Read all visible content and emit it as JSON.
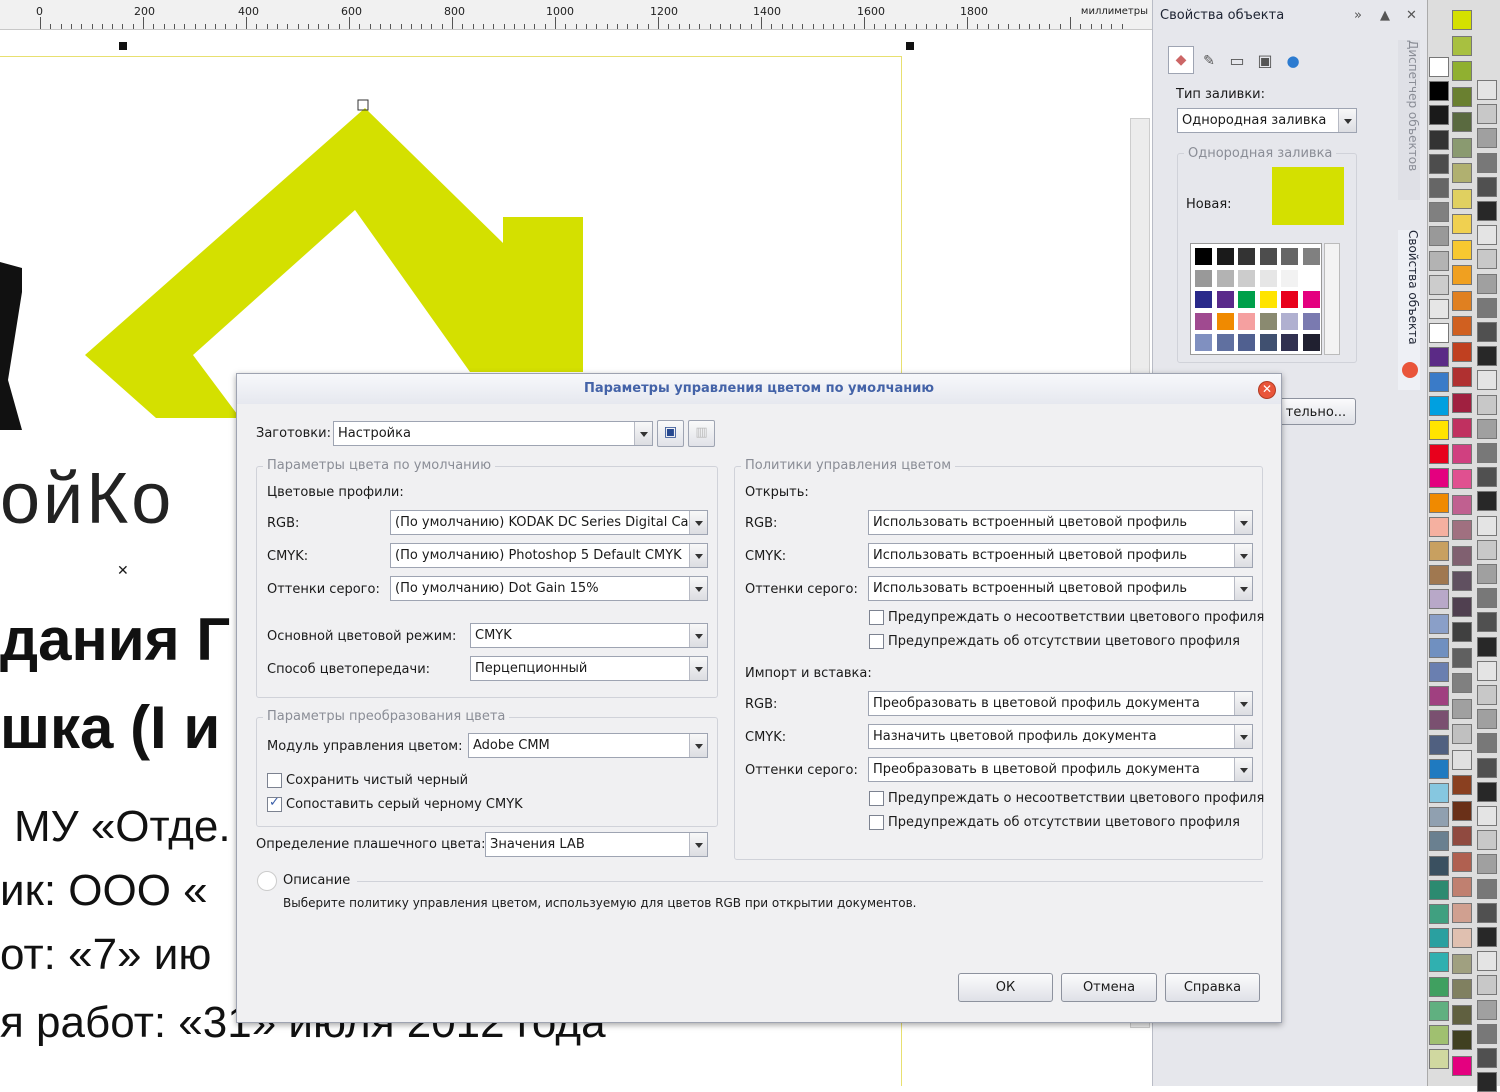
{
  "ruler": {
    "labels": [
      "0",
      "200",
      "400",
      "600",
      "800",
      "1000",
      "1200",
      "1400",
      "1600",
      "1800"
    ],
    "unit": "миллиметры"
  },
  "document": {
    "lines": [
      "ойКо",
      "дания Г",
      "шка (I и",
      "МУ «Отде.",
      "ик: ООО «",
      "от: «7» ию",
      "я работ: «31» июля 2012 года"
    ]
  },
  "panel": {
    "title": "Свойства объекта",
    "fill_type_label": "Тип заливки:",
    "fill_type_value": "Однородная заливка",
    "uniform_group": "Однородная заливка",
    "new_label": "Новая:",
    "fill_color": "#d4e000",
    "more_button": "тельно...",
    "side_tab_manager": "Диспетчер объектов",
    "side_tab_props": "Свойства объекта"
  },
  "dialog": {
    "title": "Параметры управления цветом по умолчанию",
    "presets_label": "Заготовки:",
    "presets_value": "Настройка",
    "default_color_group": "Параметры цвета по умолчанию",
    "profiles_label": "Цветовые профили:",
    "rgb_label": "RGB:",
    "rgb_value": "(По умолчанию) KODAK DC Series Digital Ca...",
    "cmyk_label": "CMYK:",
    "cmyk_value": "(По умолчанию) Photoshop 5 Default CMYK",
    "gray_label": "Оттенки серого:",
    "gray_value": "(По умолчанию) Dot Gain 15%",
    "primary_mode_label": "Основной цветовой режим:",
    "primary_mode_value": "CMYK",
    "rendering_label": "Способ цветопередачи:",
    "rendering_value": "Перцепционный",
    "conversion_group": "Параметры преобразования цвета",
    "cmm_label": "Модуль управления цветом:",
    "cmm_value": "Adobe CMM",
    "preserve_black": "Сохранить чистый черный",
    "preserve_black_checked": false,
    "map_gray": "Сопоставить серый черному CMYK",
    "map_gray_checked": true,
    "spot_label": "Определение плашечного цвета:",
    "spot_value": "Значения LAB",
    "policy_group": "Политики управления цветом",
    "open_label": "Открыть:",
    "open_rgb": "Использовать встроенный цветовой профиль",
    "open_cmyk": "Использовать встроенный цветовой профиль",
    "open_gray": "Использовать встроенный цветовой профиль",
    "warn_mismatch": "Предупреждать о несоответствии цветового профиля",
    "warn_missing": "Предупреждать об отсутствии цветового профиля",
    "import_label": "Импорт и вставка:",
    "import_rgb": "Преобразовать в цветовой профиль документа",
    "import_cmyk": "Назначить цветовой профиль документа",
    "import_gray": "Преобразовать в цветовой профиль документа",
    "description_label": "Описание",
    "description_text": "Выберите политику управления цветом, используемую для цветов RGB при открытии документов.",
    "ok": "ОК",
    "cancel": "Отмена",
    "help": "Справка"
  },
  "colors": {
    "logo_green": "#d4e000",
    "dialog_title": "#4463a8"
  }
}
